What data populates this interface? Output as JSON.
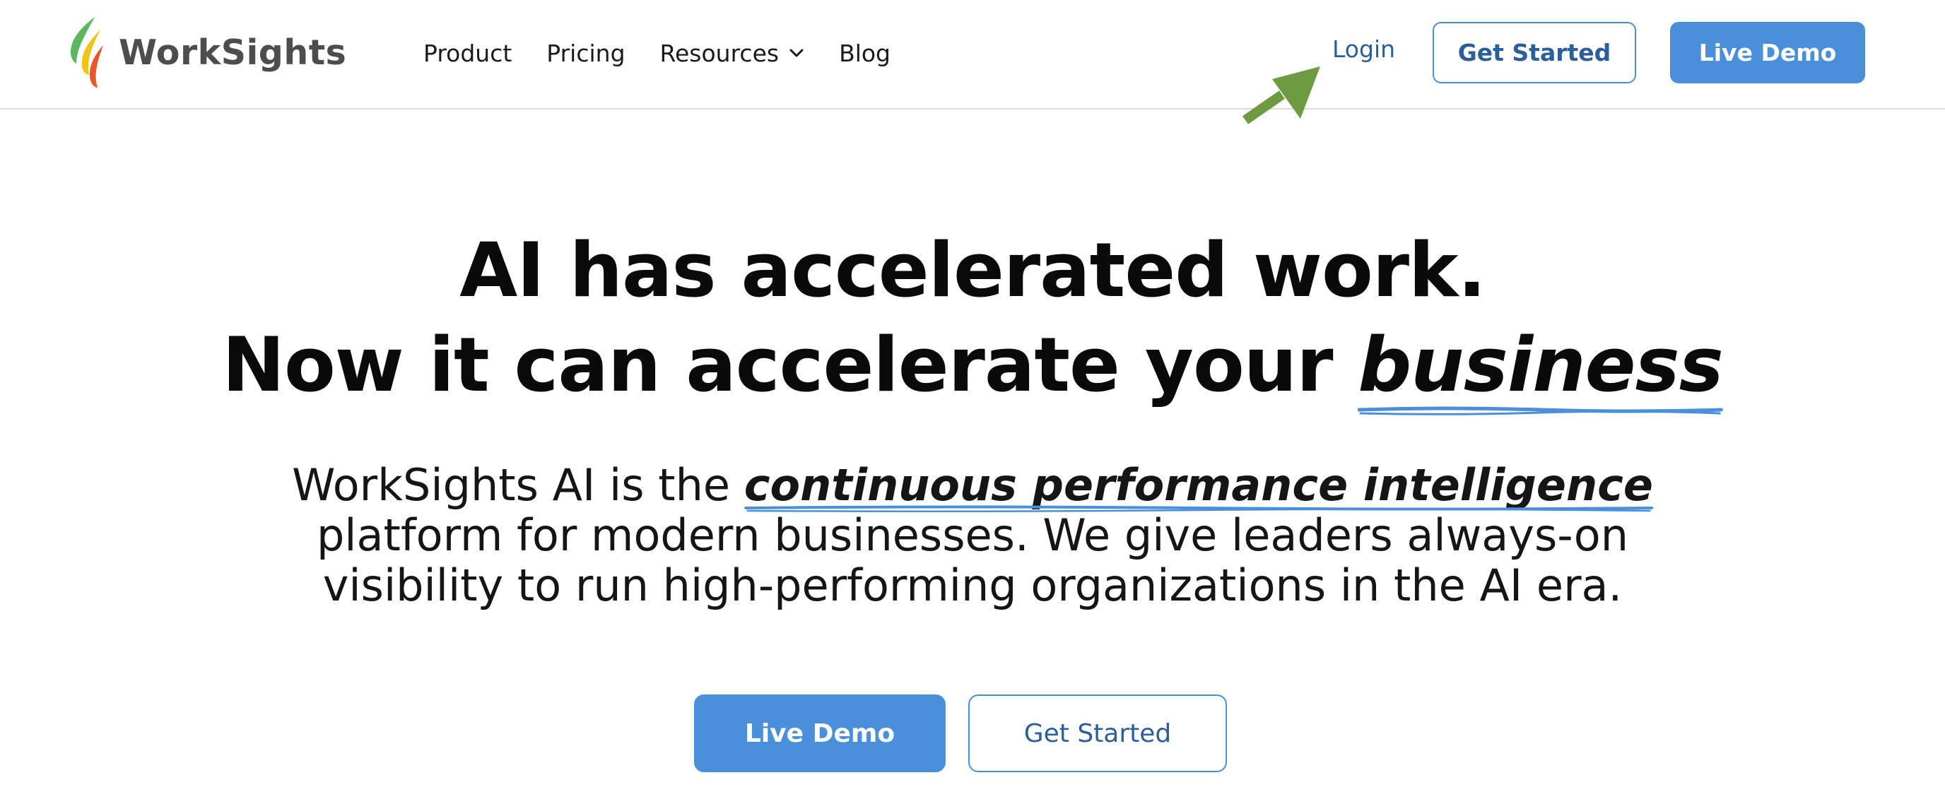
{
  "brand": {
    "name": "WorkSights",
    "logo_colors": [
      "#5cb85c",
      "#f0c419",
      "#e8572a"
    ]
  },
  "nav": {
    "items": [
      {
        "label": "Product"
      },
      {
        "label": "Pricing"
      },
      {
        "label": "Resources",
        "has_dropdown": true
      },
      {
        "label": "Blog"
      }
    ]
  },
  "header_actions": {
    "login_label": "Login",
    "get_started_label": "Get Started",
    "live_demo_label": "Live Demo"
  },
  "annotation": {
    "arrow_color": "#6e9a42",
    "arrow_points_to": "Login"
  },
  "hero": {
    "title_line1": "AI has accelerated work.",
    "title_line2_prefix": "Now it can accelerate your ",
    "title_line2_emphasis": "business",
    "subtitle_prefix": "WorkSights AI is the ",
    "subtitle_emphasis": "continuous performance intelligence",
    "subtitle_line2": "platform for modern businesses. We give leaders always-on",
    "subtitle_line3": "visibility to run high-performing organizations in the AI era."
  },
  "cta": {
    "live_demo_label": "Live Demo",
    "get_started_label": "Get Started"
  },
  "colors": {
    "accent": "#4a8fd9",
    "link": "#2c5e99",
    "underline": "#4a8fd9"
  }
}
